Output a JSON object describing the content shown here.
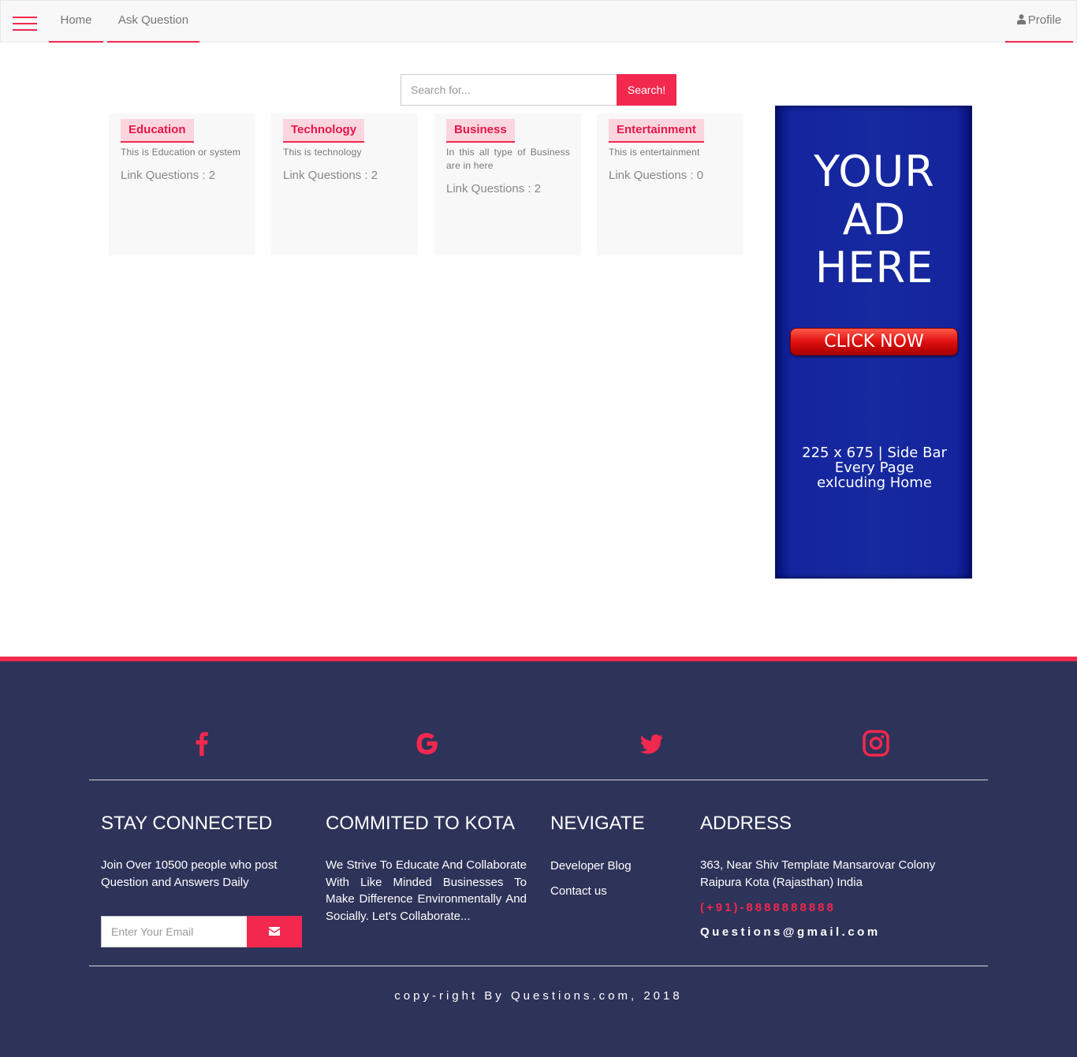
{
  "navbar": {
    "menu_icon": "hamburger-icon",
    "home": "Home",
    "ask_question": "Ask Question",
    "profile": "Profile",
    "profile_icon": "user-icon",
    "accent": "#f2284f"
  },
  "search": {
    "placeholder": "Search for...",
    "button": "Search!"
  },
  "categories": [
    {
      "name": "Education",
      "description": "This is Education or system",
      "count_label": "Link Questions : 2"
    },
    {
      "name": "Technology",
      "description": "This is technology",
      "count_label": "Link Questions : 2"
    },
    {
      "name": "Business",
      "description": "In this all type of Business are in here",
      "count_label": "Link Questions : 2"
    },
    {
      "name": "Entertainment",
      "description": "This is entertainment",
      "count_label": "Link Questions : 0"
    }
  ],
  "ad": {
    "line1": "YOUR",
    "line2": "AD",
    "line3": "HERE",
    "button": "CLICK NOW",
    "sub1": "225 x 675 |  Side Bar",
    "sub2": "Every Page",
    "sub3": "exlcuding Home"
  },
  "footer": {
    "social_icons": [
      "facebook-icon",
      "google-icon",
      "twitter-icon",
      "instagram-icon"
    ],
    "stay_connected": {
      "title": "STAY CONNECTED",
      "text1": "Join Over 10500 people who post",
      "text2": "Question and Answers Daily",
      "email_placeholder": "Enter Your Email",
      "submit_icon": "envelope-icon"
    },
    "commited": {
      "title": "COMMITED TO KOTA",
      "text": "We Strive To Educate And Collaborate With Like Minded Businesses To Make Difference Environmentally And Socially. Let's Collaborate..."
    },
    "nevigate": {
      "title": "NEVIGATE",
      "links": [
        "Developer Blog",
        "Contact us"
      ]
    },
    "address": {
      "title": "ADDRESS",
      "line1": "363, Near Shiv Template Mansarovar Colony",
      "line2": "Raipura Kota (Rajasthan) India",
      "phone": "(+91)-8888888888",
      "email": "Questions@gmail.com"
    },
    "copyright": "copy-right By Questions.com, 2018",
    "bg": "#2e3359"
  }
}
